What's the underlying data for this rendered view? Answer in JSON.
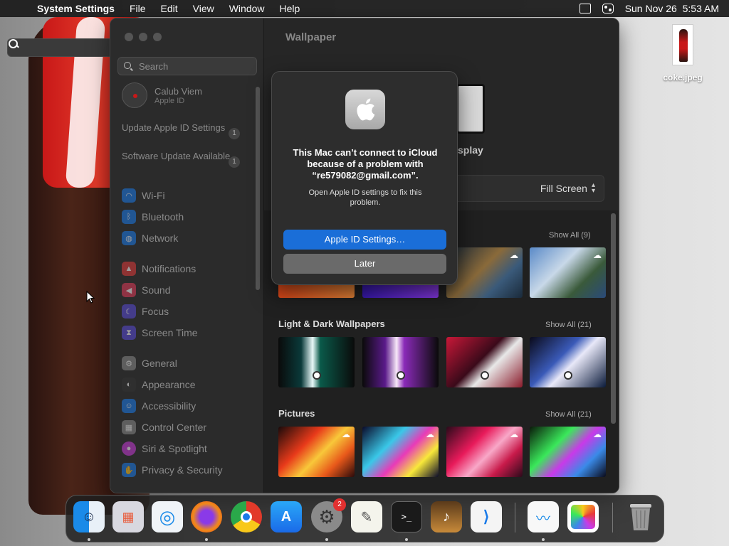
{
  "menubar": {
    "app_name": "System Settings",
    "menus": [
      "File",
      "Edit",
      "View",
      "Window",
      "Help"
    ],
    "datetime": "Sun Nov 26  5:53 AM"
  },
  "desktop": {
    "file_name": "coke.jpeg"
  },
  "sidebar": {
    "search_placeholder": "Search",
    "profile_name": "Calub Viem",
    "profile_sub": "Apple ID",
    "notices": [
      {
        "label": "Update Apple ID Settings",
        "count": "1"
      },
      {
        "label": "Software Update Available",
        "count": "1"
      }
    ],
    "items": [
      {
        "label": "Wi-Fi",
        "icon": "wifi-icon",
        "color": "#1a7ae8"
      },
      {
        "label": "Bluetooth",
        "icon": "bluetooth-icon",
        "color": "#1a7ae8"
      },
      {
        "label": "Network",
        "icon": "globe-icon",
        "color": "#1a7ae8"
      },
      {
        "label": "Notifications",
        "icon": "bell-icon",
        "color": "#e23a3a"
      },
      {
        "label": "Sound",
        "icon": "speaker-icon",
        "color": "#e23a5a"
      },
      {
        "label": "Focus",
        "icon": "moon-icon",
        "color": "#5a4ad8"
      },
      {
        "label": "Screen Time",
        "icon": "hourglass-icon",
        "color": "#5a4ad8"
      },
      {
        "label": "General",
        "icon": "gear-icon",
        "color": "#888888"
      },
      {
        "label": "Appearance",
        "icon": "appearance-icon",
        "color": "#333333"
      },
      {
        "label": "Accessibility",
        "icon": "accessibility-icon",
        "color": "#1a7ae8"
      },
      {
        "label": "Control Center",
        "icon": "control-center-icon",
        "color": "#888888"
      },
      {
        "label": "Siri & Spotlight",
        "icon": "siri-icon",
        "color": "#c83ad8"
      },
      {
        "label": "Privacy & Security",
        "icon": "hand-icon",
        "color": "#1a7ae8"
      }
    ]
  },
  "main": {
    "title": "Wallpaper",
    "display_label": "splay",
    "fill_mode": "Fill Screen",
    "sections": [
      {
        "title": "",
        "show_all": "Show All (9)"
      },
      {
        "title": "Light & Dark Wallpapers",
        "show_all": "Show All (21)"
      },
      {
        "title": "Pictures",
        "show_all": "Show All (21)"
      }
    ]
  },
  "alert": {
    "title": "This Mac can’t connect to iCloud because of a problem with “re579082@gmail.com”.",
    "body": "Open Apple ID settings to fix this problem.",
    "primary_button": "Apple ID Settings…",
    "secondary_button": "Later",
    "accent_color": "#1a6ed8"
  },
  "dock": {
    "badge_count": "2",
    "apps": [
      "finder-icon",
      "launchpad-icon",
      "safari-icon",
      "firefox-icon",
      "chrome-icon",
      "app-store-icon",
      "system-settings-icon",
      "textedit-icon",
      "terminal-icon",
      "garageband-icon",
      "vscode-icon",
      "freeform-icon",
      "photos-icon",
      "trash-icon"
    ]
  }
}
